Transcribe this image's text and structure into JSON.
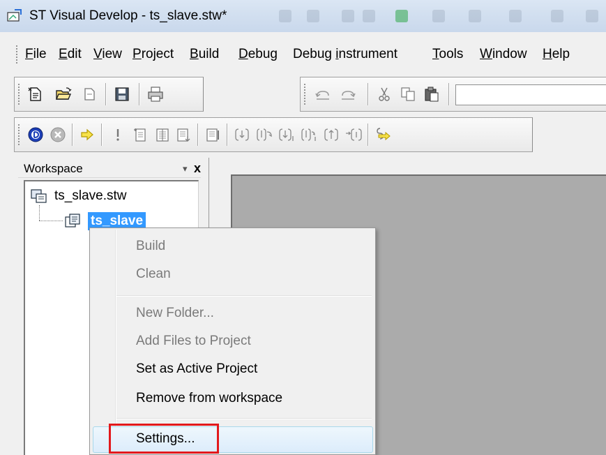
{
  "window": {
    "title": "ST Visual Develop - ts_slave.stw*"
  },
  "menubar": {
    "items": [
      {
        "u": "F",
        "rest": "ile"
      },
      {
        "u": "E",
        "rest": "dit"
      },
      {
        "u": "V",
        "rest": "iew"
      },
      {
        "u": "P",
        "rest": "roject"
      },
      {
        "u": "B",
        "rest": "uild"
      },
      {
        "u": "D",
        "rest": "ebug"
      },
      {
        "pre": "Debug ",
        "u": "i",
        "rest": "nstrument"
      },
      {
        "u": "T",
        "rest": "ools"
      },
      {
        "u": "W",
        "rest": "indow"
      },
      {
        "u": "H",
        "rest": "elp"
      }
    ]
  },
  "toolbar1": {
    "icons": [
      "new-file-icon",
      "open-folder-icon",
      "new-workspace-icon",
      "save-icon",
      "print-icon"
    ]
  },
  "toolbar2": {
    "icons": [
      "undo-icon",
      "redo-icon",
      "cut-icon",
      "copy-icon",
      "paste-icon"
    ]
  },
  "toolbar3": {
    "icons": [
      "debug-start-icon",
      "debug-stop-icon",
      "run-arrow-icon",
      "exclamation-icon",
      "compile-icon",
      "build-icon",
      "rebuild-icon",
      "batch-build-icon",
      "step-into-icon",
      "step-over-icon",
      "step-into-instr-icon",
      "step-over-instr-icon",
      "step-out-icon",
      "run-to-cursor-icon",
      "stop-build-icon"
    ]
  },
  "workspace": {
    "header": "Workspace",
    "pin": "▾",
    "close": "x",
    "tree_root": "ts_slave.stw",
    "tree_child": "ts_slave"
  },
  "context_menu": {
    "items": [
      {
        "label": "Build",
        "enabled": false
      },
      {
        "label": "Clean",
        "enabled": false
      },
      {
        "label": "New Folder...",
        "enabled": false
      },
      {
        "label": "Add Files to Project",
        "enabled": false
      },
      {
        "label": "Set as Active Project",
        "enabled": true
      },
      {
        "label": "Remove from workspace",
        "enabled": true
      },
      {
        "label": "Settings...",
        "enabled": true,
        "hovered": true
      }
    ]
  },
  "colors": {
    "selection": "#3399ff",
    "highlight_border": "#e2191c",
    "editor_bg": "#ababab",
    "chrome": "#f0f0f0"
  }
}
